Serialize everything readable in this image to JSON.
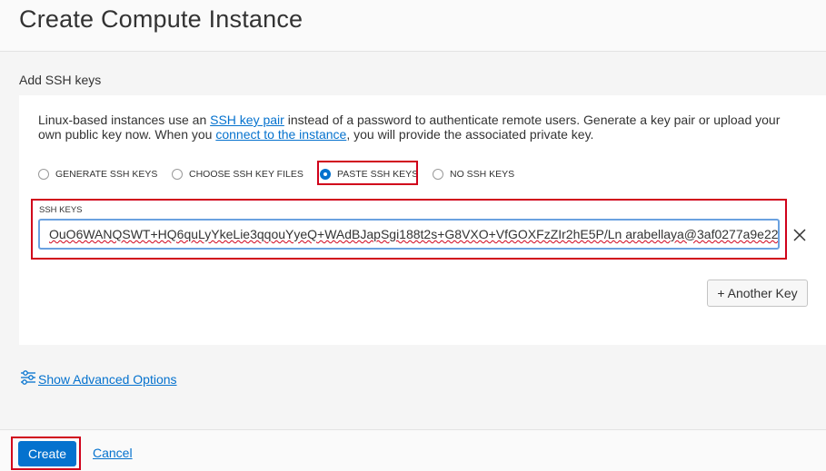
{
  "page": {
    "title": "Create Compute Instance"
  },
  "ssh": {
    "section_label": "Add SSH keys",
    "description_before_link1": "Linux-based instances use an ",
    "link1": "SSH key pair",
    "description_between_links": " instead of a password to authenticate remote users. Generate a key pair or upload your own public key now. When you ",
    "link2": "connect to the instance",
    "description_after_link2": ", you will provide the associated private key.",
    "options": [
      {
        "label": "GENERATE SSH KEYS",
        "selected": false
      },
      {
        "label": "CHOOSE SSH KEY FILES",
        "selected": false
      },
      {
        "label": "PASTE SSH KEYS",
        "selected": true
      },
      {
        "label": "NO SSH KEYS",
        "selected": false
      }
    ],
    "field_label": "SSH KEYS",
    "field_value": "OuO6WANQSWT+HQ6quLyYkeLie3qqouYyeQ+WAdBJapSgi188t2s+G8VXO+VfGOXFzZIr2hE5P/Ln arabellaya@3af0277a9e22",
    "another_key_label": "+ Another Key"
  },
  "advanced": {
    "label": "Show Advanced Options"
  },
  "footer": {
    "create_label": "Create",
    "cancel_label": "Cancel"
  },
  "colors": {
    "accent": "#0572ce",
    "highlight": "#d0021b"
  }
}
